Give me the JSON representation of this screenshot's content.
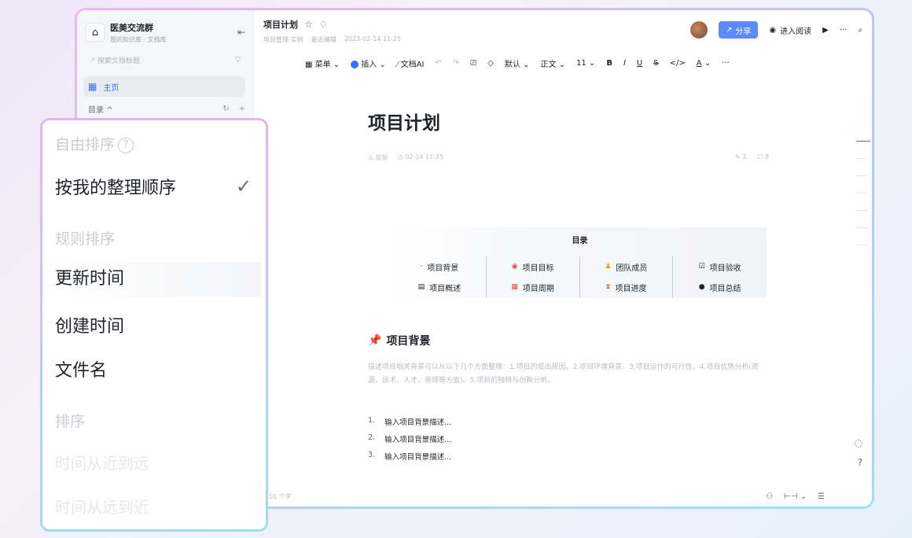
{
  "sidebar": {
    "workspace_name": "医美交流群",
    "workspace_sub": "我的知识库 · 文档库",
    "search_placeholder": "搜索文档标题",
    "home_label": "主页",
    "directory_label": "目录 ^"
  },
  "header": {
    "doc_title": "项目计划",
    "path": "项目管理-实例",
    "editor_meta": "最近编辑",
    "timestamp": "2023-02-14 11:25",
    "share_label": "分享",
    "read_label": "进入阅读",
    "more": "···"
  },
  "toolbar": {
    "menu": "菜单",
    "insert": "插入",
    "ai": "文档AI",
    "font_default": "默认",
    "style_text": "正文",
    "font_size": "11",
    "bold": "B",
    "italic": "I",
    "underline": "U",
    "strike": "S",
    "code": "</>",
    "color": "A",
    "more": "···"
  },
  "document": {
    "title": "项目计划",
    "author": "吴斩",
    "date": "02-14 11:25",
    "edits": "3",
    "comments": "8",
    "toc": {
      "title": "目录",
      "items": [
        [
          "项目背景",
          "项目概述"
        ],
        [
          "项目目标",
          "项目周期"
        ],
        [
          "团队成员",
          "项目进度"
        ],
        [
          "项目验收",
          "项目总结"
        ]
      ]
    },
    "section_title": "项目背景",
    "section_desc": "描述项目相关背景可以从以下几个方面整理：1.项目的提出原因。2.项目环境背景。3.项目运作的可行性。4.项目优势分析(资源、技术、人才、管理等方面)。5.项目的独特与创新分析。",
    "list": [
      {
        "n": "1.",
        "text": "输入项目背景描述..."
      },
      {
        "n": "2.",
        "text": "输入项目背景描述..."
      },
      {
        "n": "3.",
        "text": "输入项目背景描述..."
      }
    ]
  },
  "status": {
    "word_count": "201 个字"
  },
  "sort_popup": {
    "free_sort_label": "自由排序",
    "my_order": "按我的整理顺序",
    "rule_label": "规则排序",
    "update_time": "更新时间",
    "create_time": "创建时间",
    "file_name": "文件名",
    "order_label": "排序",
    "near_to_far": "时间从近到远",
    "far_to_near": "时间从远到近"
  },
  "colors": {
    "accent": "#3370ff",
    "share_button": "#5d8bff"
  }
}
